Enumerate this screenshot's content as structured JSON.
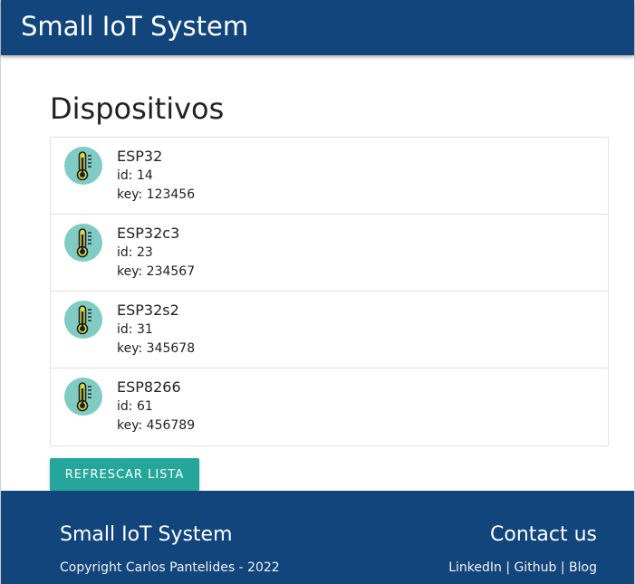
{
  "navbar": {
    "brand": "Small IoT System"
  },
  "main": {
    "title": "Dispositivos",
    "devices": [
      {
        "name": "ESP32",
        "id": "id: 14",
        "key": "key: 123456",
        "icon": "thermometer-icon"
      },
      {
        "name": "ESP32c3",
        "id": "id: 23",
        "key": "key: 234567",
        "icon": "thermometer-icon"
      },
      {
        "name": "ESP32s2",
        "id": "id: 31",
        "key": "key: 345678",
        "icon": "thermometer-icon"
      },
      {
        "name": "ESP8266",
        "id": "id: 61",
        "key": "key: 456789",
        "icon": "thermometer-icon"
      }
    ],
    "refresh_button": "Refrescar lista"
  },
  "footer": {
    "title": "Small IoT System",
    "copyright": "Copyright Carlos Pantelides - 2022",
    "contact_title": "Contact us",
    "links": [
      "LinkedIn",
      "Github",
      "Blog"
    ],
    "separator": "|"
  },
  "colors": {
    "primary": "#12457c",
    "accent": "#26a69a",
    "avatar_bg": "#80cbc4",
    "thermometer_fill": "#d7d94a"
  }
}
